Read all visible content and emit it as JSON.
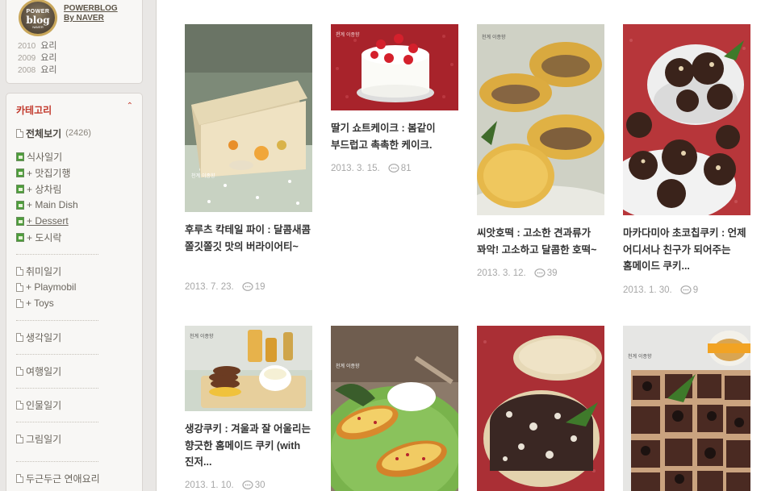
{
  "profile": {
    "badge_line1": "POWER",
    "badge_line2": "blog",
    "badge_line3": "NAVER",
    "title": "POWERBLOG",
    "subtitle": "By NAVER",
    "awards": [
      {
        "year": "2010",
        "name": "요리"
      },
      {
        "year": "2009",
        "name": "요리"
      },
      {
        "year": "2008",
        "name": "요리"
      }
    ]
  },
  "categories": {
    "heading": "카테고리",
    "all_label": "전체보기",
    "all_count": "(2426)",
    "group1": [
      {
        "label": "식사일기",
        "icon": "pic"
      },
      {
        "label": "+ 맛집기행",
        "icon": "pic"
      },
      {
        "label": "+ 상차림",
        "icon": "pic"
      },
      {
        "label": "+ Main Dish",
        "icon": "pic"
      },
      {
        "label": "+ Dessert",
        "icon": "pic",
        "underline": true
      },
      {
        "label": "+ 도시락",
        "icon": "pic"
      }
    ],
    "group2": [
      {
        "label": "취미일기"
      },
      {
        "label": "+ Playmobil"
      },
      {
        "label": "+ Toys"
      }
    ],
    "singles": [
      "생각일기",
      "여행일기",
      "인물일기",
      "그림일기"
    ],
    "last": "두근두근 연애요리"
  },
  "posts": [
    {
      "title": "후루츠 칵테일 파이 : 달콤새콤 쫄깃쫄깃 맛의 버라이어티~",
      "date": "2013. 7. 23.",
      "comments": "19",
      "image": "fruit-pie"
    },
    {
      "title": "딸기 쇼트케이크 : 봄같이 부드럽고 촉촉한 케이크.",
      "date": "2013. 3. 15.",
      "comments": "81",
      "image": "strawberry-cake"
    },
    {
      "title": "씨앗호떡 : 고소한 견과류가 꽈악! 고소하고 달콤한 호떡~",
      "date": "2013. 3. 12.",
      "comments": "39",
      "image": "seed-hotteok"
    },
    {
      "title": "마카다미아 초코칩쿠키 : 언제 어디서나 친구가 되어주는 홈메이드 쿠키...",
      "date": "2013. 1. 30.",
      "comments": "9",
      "image": "choco-cookies"
    },
    {
      "title": "생강쿠키 : 겨울과 잘 어울리는 향긋한 홈메이드 쿠키 (with 진저...",
      "date": "2013. 1. 10.",
      "comments": "30",
      "image": "ginger-cookies"
    },
    {
      "title": "",
      "date": "",
      "comments": "",
      "image": "baked-sweet-potato"
    },
    {
      "title": "",
      "date": "",
      "comments": "",
      "image": "chocolate-salami"
    },
    {
      "title": "",
      "date": "",
      "comments": "",
      "image": "oreo-brownies"
    }
  ],
  "colors": {
    "accent": "#c2392c",
    "sidebar_bg": "#e9e7e5",
    "box_bg": "#f8f7f5",
    "title_text": "#333333",
    "meta_text": "#a7a7a7"
  }
}
